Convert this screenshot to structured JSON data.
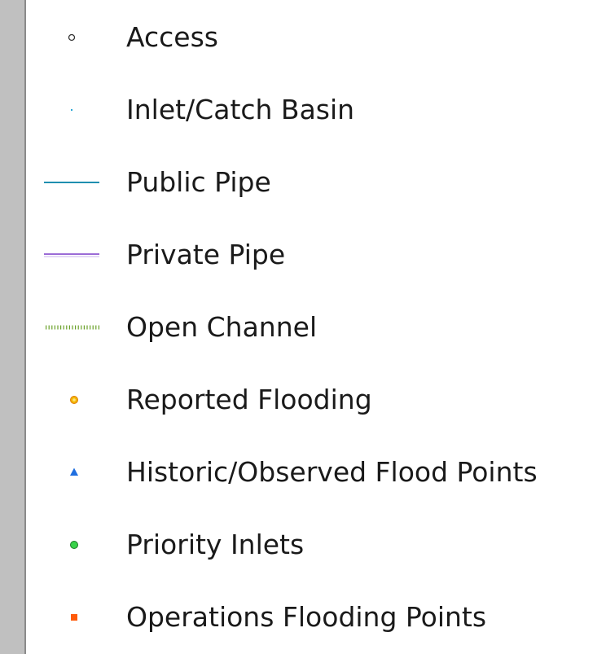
{
  "legend": {
    "items": [
      {
        "label": "Access",
        "icon": "hollow-circle-icon",
        "color": "#333333"
      },
      {
        "label": "Inlet/Catch Basin",
        "icon": "dot-icon",
        "color": "#2aa7d6"
      },
      {
        "label": "Public Pipe",
        "icon": "solid-line-icon",
        "color": "#1f8fb0"
      },
      {
        "label": "Private Pipe",
        "icon": "double-line-icon",
        "color": "#9b6bd6"
      },
      {
        "label": "Open Channel",
        "icon": "dashed-line-icon",
        "color": "#6aa12a"
      },
      {
        "label": "Reported Flooding",
        "icon": "ring-circle-icon",
        "color": "#f2b705"
      },
      {
        "label": "Historic/Observed Flood Points",
        "icon": "triangle-icon",
        "color": "#1f6fe0"
      },
      {
        "label": "Priority Inlets",
        "icon": "green-circle-icon",
        "color": "#39d24a"
      },
      {
        "label": "Operations Flooding Points",
        "icon": "square-icon",
        "color": "#ff5a0a"
      }
    ]
  }
}
